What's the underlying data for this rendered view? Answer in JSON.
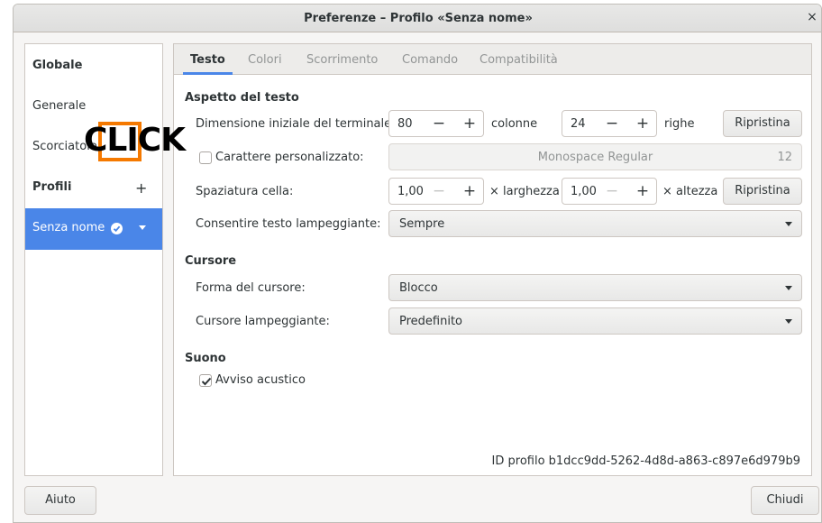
{
  "window": {
    "title": "Preferenze – Profilo «Senza nome»",
    "close_glyph": "×"
  },
  "sidebar": {
    "global_header": "Globale",
    "general": "Generale",
    "shortcuts": "Scorciatoie",
    "profiles_header": "Profili",
    "add_glyph": "+",
    "profile_name": "Senza nome"
  },
  "overlay": {
    "click_text": "CLICK",
    "highlight_color": "#f57900"
  },
  "tabs": [
    "Testo",
    "Colori",
    "Scorrimento",
    "Comando",
    "Compatibilità"
  ],
  "text_section": {
    "title": "Aspetto del testo",
    "initial_size_label": "Dimensione iniziale del terminale:",
    "columns_value": "80",
    "columns_unit": "colonne",
    "rows_value": "24",
    "rows_unit": "righe",
    "reset_label": "Ripristina",
    "custom_font_label": "Carattere personalizzato:",
    "custom_font_checked": false,
    "font_name": "Monospace Regular",
    "font_size": "12",
    "cell_spacing_label": "Spaziatura cella:",
    "width_value": "1,00",
    "width_unit": "× larghezza",
    "height_value": "1,00",
    "height_unit": "× altezza",
    "reset2_label": "Ripristina",
    "blink_label": "Consentire testo lampeggiante:",
    "blink_value": "Sempre"
  },
  "cursor_section": {
    "title": "Cursore",
    "shape_label": "Forma del cursore:",
    "shape_value": "Blocco",
    "blink_label": "Cursore lampeggiante:",
    "blink_value": "Predefinito"
  },
  "sound_section": {
    "title": "Suono",
    "bell_label": "Avviso acustico",
    "bell_checked": true
  },
  "profile_id_text": "ID profilo  b1dcc9dd-5262-4d8d-a863-c897e6d979b9",
  "footer": {
    "help": "Aiuto",
    "close": "Chiudi"
  },
  "glyphs": {
    "minus": "−",
    "plus": "+"
  },
  "colors": {
    "accent": "#4a86e8",
    "orange": "#f57900"
  }
}
